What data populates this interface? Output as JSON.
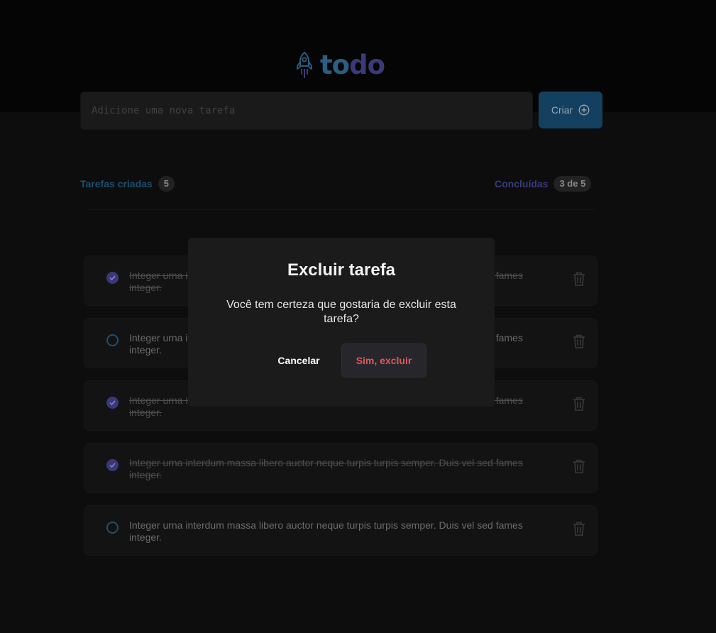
{
  "app": {
    "logo_text_part1": "to",
    "logo_text_part2": "do"
  },
  "new_task": {
    "placeholder": "Adicione uma nova tarefa",
    "value": "",
    "create_label": "Criar"
  },
  "counters": {
    "created_label": "Tarefas criadas",
    "created_count": "5",
    "done_label": "Concluídas",
    "done_count": "3 de 5"
  },
  "tasks": [
    {
      "text": "Integer urna interdum massa libero auctor neque turpis turpis semper. Duis vel sed fames integer.",
      "completed": true
    },
    {
      "text": "Integer urna interdum massa libero auctor neque turpis turpis semper. Duis vel sed fames integer.",
      "completed": false
    },
    {
      "text": "Integer urna interdum massa libero auctor neque turpis turpis semper. Duis vel sed fames integer.",
      "completed": true
    },
    {
      "text": "Integer urna interdum massa libero auctor neque turpis turpis semper. Duis vel sed fames integer.",
      "completed": true
    },
    {
      "text": "Integer urna interdum massa libero auctor neque turpis turpis semper. Duis vel sed fames integer.",
      "completed": false
    }
  ],
  "modal": {
    "title": "Excluir tarefa",
    "message": "Você tem certeza que gostaria de excluir esta tarefa?",
    "cancel_label": "Cancelar",
    "confirm_label": "Sim, excluir"
  },
  "colors": {
    "background": "#0d0d0d",
    "header_background": "#050505",
    "brand_blue": "#1e4f70",
    "brand_purple": "#3c3a7c",
    "danger": "#e25858"
  },
  "icons": {
    "logo": "rocket-icon",
    "create": "plus-circle-icon",
    "check": "check-icon",
    "delete": "trash-icon"
  }
}
